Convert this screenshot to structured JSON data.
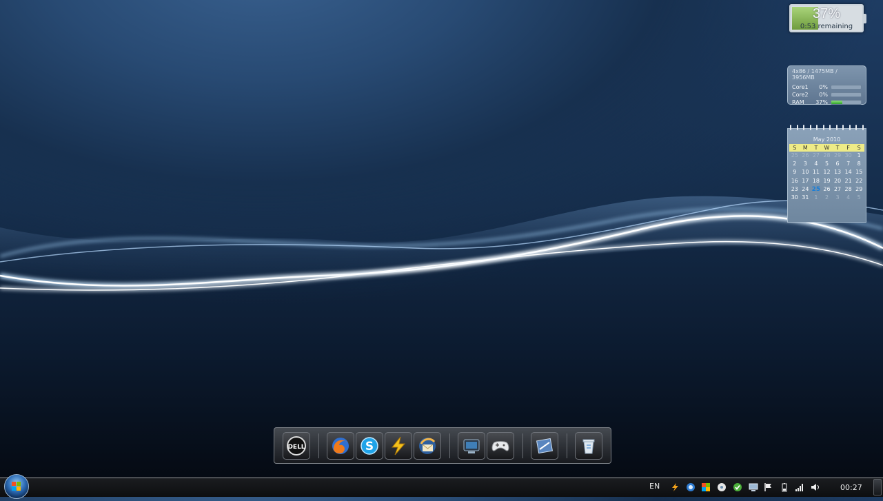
{
  "battery": {
    "percent": "37%",
    "remaining": "0:53 remaining",
    "level": 0.37
  },
  "cpu_meter": {
    "header": "4x86 / 1475MB / 3956MB",
    "rows": [
      {
        "label": "Core1",
        "value": "0%",
        "level": 0.0
      },
      {
        "label": "Core2",
        "value": "0%",
        "level": 0.0
      },
      {
        "label": "RAM",
        "value": "37%",
        "level": 0.37
      }
    ]
  },
  "calendar": {
    "title": "May 2010",
    "weekdays": [
      "S",
      "M",
      "T",
      "W",
      "T",
      "F",
      "S"
    ],
    "days": [
      {
        "d": "25",
        "other": true
      },
      {
        "d": "26",
        "other": true
      },
      {
        "d": "27",
        "other": true
      },
      {
        "d": "28",
        "other": true
      },
      {
        "d": "29",
        "other": true
      },
      {
        "d": "30",
        "other": true
      },
      {
        "d": "1"
      },
      {
        "d": "2"
      },
      {
        "d": "3"
      },
      {
        "d": "4"
      },
      {
        "d": "5"
      },
      {
        "d": "6"
      },
      {
        "d": "7"
      },
      {
        "d": "8"
      },
      {
        "d": "9"
      },
      {
        "d": "10"
      },
      {
        "d": "11"
      },
      {
        "d": "12"
      },
      {
        "d": "13"
      },
      {
        "d": "14"
      },
      {
        "d": "15"
      },
      {
        "d": "16"
      },
      {
        "d": "17"
      },
      {
        "d": "18"
      },
      {
        "d": "19"
      },
      {
        "d": "20"
      },
      {
        "d": "21"
      },
      {
        "d": "22"
      },
      {
        "d": "23"
      },
      {
        "d": "24"
      },
      {
        "d": "25",
        "today": true
      },
      {
        "d": "26"
      },
      {
        "d": "27"
      },
      {
        "d": "28"
      },
      {
        "d": "29"
      },
      {
        "d": "30"
      },
      {
        "d": "31"
      },
      {
        "d": "1",
        "other": true
      },
      {
        "d": "2",
        "other": true
      },
      {
        "d": "3",
        "other": true
      },
      {
        "d": "4",
        "other": true
      },
      {
        "d": "5",
        "other": true
      }
    ]
  },
  "dock": {
    "items": [
      {
        "name": "dell-icon",
        "label": "DELL"
      },
      {
        "name": "firefox-icon"
      },
      {
        "name": "skype-icon",
        "label": "S"
      },
      {
        "name": "winamp-icon"
      },
      {
        "name": "thunderbird-icon"
      },
      {
        "name": "media-center-icon"
      },
      {
        "name": "gamepad-icon"
      },
      {
        "name": "system-settings-icon"
      },
      {
        "name": "recycle-bin-icon"
      }
    ]
  },
  "taskbar": {
    "language": "EN",
    "clock": "00:27",
    "tray_icons": [
      "winamp-tray-icon",
      "network-tray-icon",
      "windows-flag-tray-icon",
      "disc-tray-icon",
      "checkmark-tray-icon",
      "display-tray-icon",
      "action-center-flag-icon",
      "battery-tray-icon",
      "signal-tray-icon",
      "volume-tray-icon"
    ]
  },
  "colors": {
    "accent": "#1b7fd8",
    "battery_fill": "#8cbf5a",
    "calendar_weekday_bg": "#eeeb86"
  }
}
